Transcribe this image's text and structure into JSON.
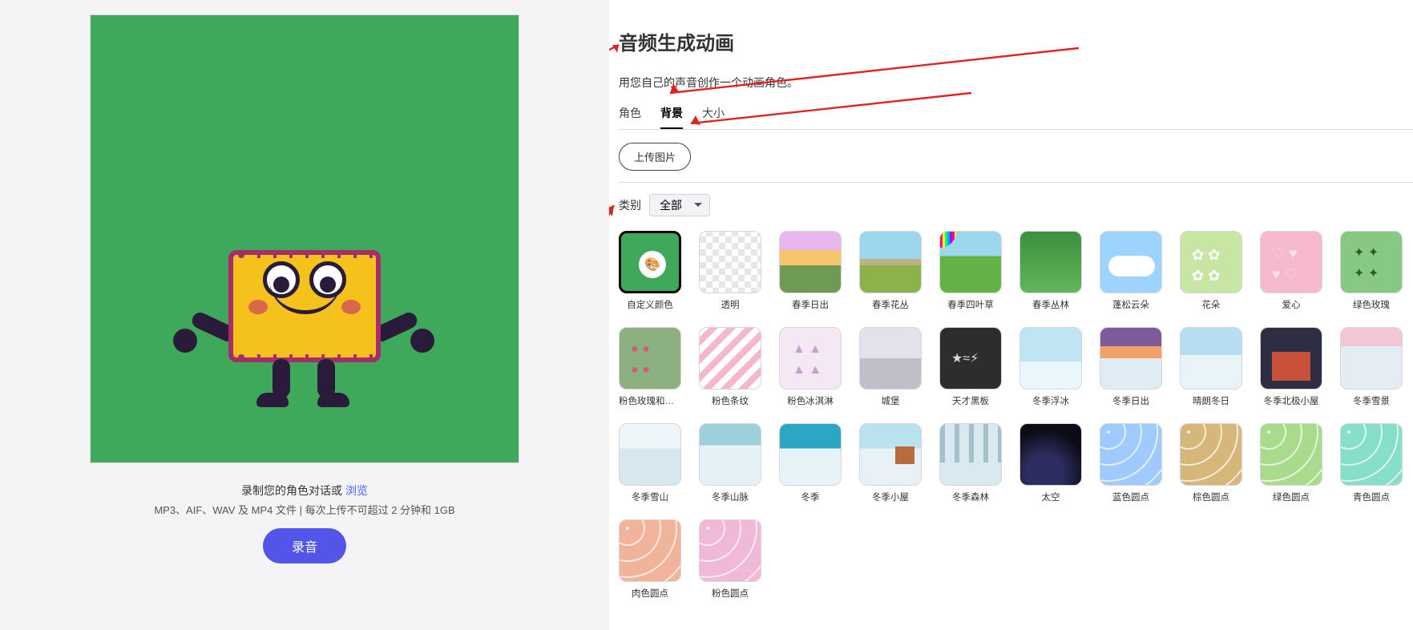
{
  "left": {
    "caption_prefix": "录制您的角色对话或",
    "browse": "浏览",
    "caption_sub": "MP3、AIF、WAV 及 MP4 文件 | 每次上传不可超过 2 分钟和 1GB",
    "record_btn": "录音"
  },
  "right": {
    "title": "音频生成动画",
    "subtitle": "用您自己的声音创作一个动画角色。",
    "tabs": [
      "角色",
      "背景",
      "大小"
    ],
    "active_tab": "背景",
    "upload_btn": "上传图片",
    "category_label": "类别",
    "category_selected": "全部",
    "tiles": [
      {
        "label": "自定义颜色",
        "cls": "t-customcolor",
        "selected": true
      },
      {
        "label": "透明",
        "cls": "t-transparent"
      },
      {
        "label": "春季日出",
        "cls": "t-sunrise"
      },
      {
        "label": "春季花丛",
        "cls": "t-springflowers"
      },
      {
        "label": "春季四叶草",
        "cls": "t-clover"
      },
      {
        "label": "春季丛林",
        "cls": "t-jungle"
      },
      {
        "label": "蓬松云朵",
        "cls": "t-fluffycloud"
      },
      {
        "label": "花朵",
        "cls": "t-flowers"
      },
      {
        "label": "爱心",
        "cls": "t-hearts"
      },
      {
        "label": "绿色玫瑰",
        "cls": "t-greenrose"
      },
      {
        "label": "粉色玫瑰和绿叶",
        "cls": "t-pinkrose"
      },
      {
        "label": "粉色条纹",
        "cls": "t-pinkstripe"
      },
      {
        "label": "粉色冰淇淋",
        "cls": "t-icecream"
      },
      {
        "label": "城堡",
        "cls": "t-castle"
      },
      {
        "label": "天才黑板",
        "cls": "t-blackboard"
      },
      {
        "label": "冬季浮冰",
        "cls": "t-winterice"
      },
      {
        "label": "冬季日出",
        "cls": "t-wintersunrise"
      },
      {
        "label": "晴朗冬日",
        "cls": "t-sunnywinter"
      },
      {
        "label": "冬季北极小屋",
        "cls": "t-arcticcabin"
      },
      {
        "label": "冬季雪景",
        "cls": "t-wintersnow"
      },
      {
        "label": "冬季雪山",
        "cls": "t-wintermount"
      },
      {
        "label": "冬季山脉",
        "cls": "t-winterrange"
      },
      {
        "label": "冬季",
        "cls": "t-winter"
      },
      {
        "label": "冬季小屋",
        "cls": "t-wintercabin"
      },
      {
        "label": "冬季森林",
        "cls": "t-winterforest"
      },
      {
        "label": "太空",
        "cls": "t-space"
      },
      {
        "label": "蓝色圆点",
        "cls": "t-bluedot dotty"
      },
      {
        "label": "棕色圆点",
        "cls": "t-tandot dotty"
      },
      {
        "label": "绿色圆点",
        "cls": "t-greendot dotty"
      },
      {
        "label": "青色圆点",
        "cls": "t-cyandot dotty"
      },
      {
        "label": "肉色圆点",
        "cls": "t-fleshdot dotty"
      },
      {
        "label": "粉色圆点",
        "cls": "t-pinkdot dotty"
      }
    ]
  }
}
